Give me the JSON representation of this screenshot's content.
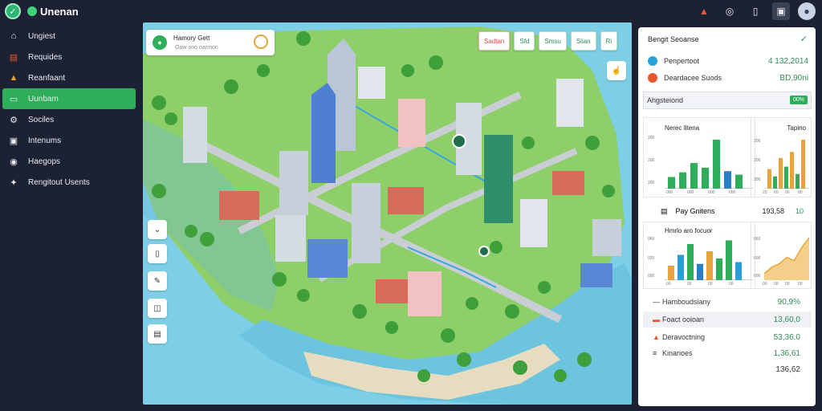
{
  "app": {
    "title": "Unenan"
  },
  "topbar": {
    "icons": [
      "fire-icon",
      "search-icon",
      "mic-icon",
      "share-icon",
      "avatar-icon"
    ]
  },
  "sidebar": {
    "items": [
      {
        "label": "Ungiest",
        "icon": "home-icon",
        "active": false
      },
      {
        "label": "Requides",
        "icon": "list-icon",
        "active": false
      },
      {
        "label": "Reanfaant",
        "icon": "warning-icon",
        "active": false
      },
      {
        "label": "Uunbam",
        "icon": "map-icon",
        "active": true
      },
      {
        "label": "Sociles",
        "icon": "gear-icon",
        "active": false
      },
      {
        "label": "Intenums",
        "icon": "lock-icon",
        "active": false
      },
      {
        "label": "Haegops",
        "icon": "compass-icon",
        "active": false
      },
      {
        "label": "Rengitout Usents",
        "icon": "star-icon",
        "active": false
      }
    ]
  },
  "map": {
    "search": {
      "title": "Hamory Gett",
      "subtitle": "Oaw ono oarmon"
    },
    "chips": [
      {
        "label": "Sadtan",
        "tone": "red"
      },
      {
        "label": "Sfd",
        "tone": "green"
      },
      {
        "label": "Smsu",
        "tone": "green"
      },
      {
        "label": "Siian",
        "tone": "green"
      },
      {
        "label": "Ri",
        "tone": "green"
      }
    ]
  },
  "panel": {
    "header": "Bengit Seoanse",
    "summary": [
      {
        "label": "Penpertoot",
        "value": "4  132,2014",
        "color": "#2aa3d8"
      },
      {
        "label": "Deardacee Suods",
        "value": "BD,90ni",
        "color": "#e8562e"
      }
    ],
    "section": {
      "label": "Ahgsteiond",
      "badge": "00%"
    },
    "chart1": {
      "title": "Nerec Iltena",
      "value": "Tapino",
      "yticks": [
        "200",
        "200",
        "200"
      ],
      "xticks": [
        "000",
        "000",
        "000",
        "000"
      ],
      "values": [
        10,
        14,
        22,
        18,
        42,
        15,
        12
      ],
      "colors": [
        "#2fae5a",
        "#2fae5a",
        "#2fae5a",
        "#2fae5a",
        "#2fae5a",
        "#2a7ec8",
        "#2fae5a"
      ]
    },
    "chart2": {
      "yticks": [
        "200",
        "200",
        "300"
      ],
      "xticks": [
        "20",
        "60",
        "00",
        "80"
      ],
      "values": [
        16,
        10,
        25,
        18,
        30,
        12,
        40
      ],
      "colors": [
        "#e8a43c",
        "#2fae5a",
        "#e8a43c",
        "#2fae5a",
        "#e8a43c",
        "#2fae5a",
        "#e8a43c"
      ]
    },
    "row_mid": {
      "label": "Pay Gnitens",
      "value": "193,58",
      "extra": "10"
    },
    "chart3": {
      "title": "Hmrlo aro focuor",
      "value": "",
      "yticks": [
        "060",
        "020",
        "000"
      ],
      "xticks": [
        "00",
        "00",
        "00",
        "00"
      ],
      "values": [
        8,
        14,
        20,
        9,
        16,
        12,
        22,
        10
      ],
      "colors": [
        "#e8a43c",
        "#2a9fd8",
        "#2fae5a",
        "#2a7ec8",
        "#e8a43c",
        "#2fae5a",
        "#2fae5a",
        "#2a9fd8"
      ]
    },
    "chart4": {
      "yticks": [
        "060",
        "000",
        "000"
      ],
      "xticks": [
        "00",
        "00",
        "00",
        "00"
      ],
      "values": [
        4,
        8,
        10,
        14,
        12,
        20,
        26
      ]
    },
    "stats": [
      {
        "label": "Hamboudsiany",
        "value": "90,9%",
        "icon": "minus-icon",
        "shaded": false,
        "dark": false
      },
      {
        "label": "Foact ooioan",
        "value": "13,60,0",
        "icon": "car-icon",
        "shaded": true,
        "dark": false
      },
      {
        "label": "Deravoctning",
        "value": "53,36.0",
        "icon": "fire-icon",
        "shaded": false,
        "dark": false
      },
      {
        "label": "Kinarioes",
        "value": "1,36,61",
        "icon": "bars-icon",
        "shaded": false,
        "dark": false
      },
      {
        "label": "",
        "value": "136,62",
        "icon": "",
        "shaded": false,
        "dark": true
      }
    ]
  }
}
